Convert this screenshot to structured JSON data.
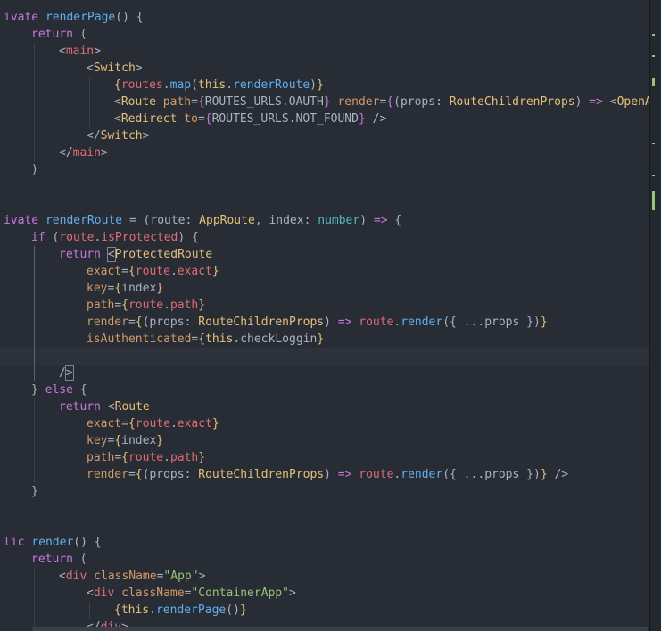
{
  "editor": {
    "lines": [
      {
        "indent": 0,
        "tokens": [
          [
            "kw",
            "ivate "
          ],
          [
            "fn",
            "renderPage"
          ],
          [
            "punc",
            "() {"
          ]
        ]
      },
      {
        "indent": 1,
        "tokens": [
          [
            "kw",
            "return"
          ],
          [
            "punc",
            " ("
          ]
        ]
      },
      {
        "indent": 2,
        "tokens": [
          [
            "punc",
            "<"
          ],
          [
            "tag",
            "main"
          ],
          [
            "punc",
            ">"
          ]
        ]
      },
      {
        "indent": 3,
        "tokens": [
          [
            "punc",
            "<"
          ],
          [
            "comp",
            "Switch"
          ],
          [
            "punc",
            ">"
          ]
        ]
      },
      {
        "indent": 4,
        "tokens": [
          [
            "brace2",
            "{"
          ],
          [
            "prop",
            "routes"
          ],
          [
            "punc",
            "."
          ],
          [
            "fn",
            "map"
          ],
          [
            "punc",
            "("
          ],
          [
            "this",
            "this"
          ],
          [
            "punc",
            "."
          ],
          [
            "fn",
            "renderRoute"
          ],
          [
            "punc",
            ")"
          ],
          [
            "brace2",
            "}"
          ]
        ]
      },
      {
        "indent": 4,
        "tokens": [
          [
            "punc",
            "<"
          ],
          [
            "comp",
            "Route"
          ],
          [
            "var",
            " "
          ],
          [
            "attr",
            "path"
          ],
          [
            "punc",
            "="
          ],
          [
            "brace",
            "{"
          ],
          [
            "var",
            "ROUTES_URLS"
          ],
          [
            "punc",
            "."
          ],
          [
            "var",
            "OAUTH"
          ],
          [
            "brace",
            "}"
          ],
          [
            "var",
            " "
          ],
          [
            "attr",
            "render"
          ],
          [
            "punc",
            "="
          ],
          [
            "brace",
            "{"
          ],
          [
            "punc",
            "("
          ],
          [
            "var",
            "props"
          ],
          [
            "punc",
            ": "
          ],
          [
            "type",
            "RouteChildrenProps"
          ],
          [
            "punc",
            ") "
          ],
          [
            "arrow",
            "=>"
          ],
          [
            "punc",
            " <"
          ],
          [
            "comp",
            "OpenAutho"
          ]
        ]
      },
      {
        "indent": 4,
        "tokens": [
          [
            "punc",
            "<"
          ],
          [
            "comp",
            "Redirect"
          ],
          [
            "var",
            " "
          ],
          [
            "attr",
            "to"
          ],
          [
            "punc",
            "="
          ],
          [
            "brace",
            "{"
          ],
          [
            "var",
            "ROUTES_URLS"
          ],
          [
            "punc",
            "."
          ],
          [
            "var",
            "NOT_FOUND"
          ],
          [
            "brace",
            "}"
          ],
          [
            "punc",
            " />"
          ]
        ]
      },
      {
        "indent": 3,
        "tokens": [
          [
            "punc",
            "</"
          ],
          [
            "comp",
            "Switch"
          ],
          [
            "punc",
            ">"
          ]
        ]
      },
      {
        "indent": 2,
        "tokens": [
          [
            "punc",
            "</"
          ],
          [
            "tag",
            "main"
          ],
          [
            "punc",
            ">"
          ]
        ]
      },
      {
        "indent": 1,
        "tokens": [
          [
            "punc",
            ")"
          ]
        ]
      },
      {
        "indent": 0,
        "tokens": []
      },
      {
        "indent": 0,
        "tokens": []
      },
      {
        "indent": 0,
        "tokens": [
          [
            "kw",
            "ivate "
          ],
          [
            "fn",
            "renderRoute"
          ],
          [
            "punc",
            " = ("
          ],
          [
            "var",
            "route"
          ],
          [
            "punc",
            ": "
          ],
          [
            "type",
            "AppRoute"
          ],
          [
            "punc",
            ", "
          ],
          [
            "var",
            "index"
          ],
          [
            "punc",
            ": "
          ],
          [
            "num",
            "number"
          ],
          [
            "punc",
            ") "
          ],
          [
            "arrow",
            "=>"
          ],
          [
            "punc",
            " {"
          ]
        ]
      },
      {
        "indent": 1,
        "tokens": [
          [
            "kw",
            "if"
          ],
          [
            "punc",
            " ("
          ],
          [
            "prop",
            "route"
          ],
          [
            "punc",
            "."
          ],
          [
            "prop",
            "isProtected"
          ],
          [
            "punc",
            ") {"
          ]
        ]
      },
      {
        "indent": 2,
        "tokens": [
          [
            "kw",
            "return"
          ],
          [
            "punc",
            " "
          ],
          [
            "cursor",
            "<"
          ],
          [
            "comp",
            "ProtectedRoute"
          ]
        ]
      },
      {
        "indent": 3,
        "tokens": [
          [
            "attr",
            "exact"
          ],
          [
            "punc",
            "="
          ],
          [
            "brace2",
            "{"
          ],
          [
            "prop",
            "route"
          ],
          [
            "punc",
            "."
          ],
          [
            "prop",
            "exact"
          ],
          [
            "brace2",
            "}"
          ]
        ]
      },
      {
        "indent": 3,
        "tokens": [
          [
            "attr",
            "key"
          ],
          [
            "punc",
            "="
          ],
          [
            "brace2",
            "{"
          ],
          [
            "var",
            "index"
          ],
          [
            "brace2",
            "}"
          ]
        ]
      },
      {
        "indent": 3,
        "tokens": [
          [
            "attr",
            "path"
          ],
          [
            "punc",
            "="
          ],
          [
            "brace2",
            "{"
          ],
          [
            "prop",
            "route"
          ],
          [
            "punc",
            "."
          ],
          [
            "prop",
            "path"
          ],
          [
            "brace2",
            "}"
          ]
        ]
      },
      {
        "indent": 3,
        "tokens": [
          [
            "attr",
            "render"
          ],
          [
            "punc",
            "="
          ],
          [
            "brace2",
            "{"
          ],
          [
            "punc",
            "("
          ],
          [
            "var",
            "props"
          ],
          [
            "punc",
            ": "
          ],
          [
            "type",
            "RouteChildrenProps"
          ],
          [
            "punc",
            ") "
          ],
          [
            "arrow",
            "=>"
          ],
          [
            "punc",
            " "
          ],
          [
            "prop",
            "route"
          ],
          [
            "punc",
            "."
          ],
          [
            "fn",
            "render"
          ],
          [
            "punc",
            "({ ..."
          ],
          [
            "var",
            "props"
          ],
          [
            "punc",
            " })"
          ],
          [
            "brace2",
            "}"
          ]
        ]
      },
      {
        "indent": 3,
        "tokens": [
          [
            "attr",
            "isAuthenticated"
          ],
          [
            "punc",
            "="
          ],
          [
            "brace2",
            "{"
          ],
          [
            "this",
            "this"
          ],
          [
            "punc",
            "."
          ],
          [
            "var",
            "checkLoggin"
          ],
          [
            "brace2",
            "}"
          ]
        ]
      },
      {
        "indent": 2,
        "current": true,
        "tokens": []
      },
      {
        "indent": 2,
        "tokens": [
          [
            "punc",
            "/"
          ],
          [
            "cursor",
            ">"
          ]
        ]
      },
      {
        "indent": 1,
        "tokens": [
          [
            "punc",
            "} "
          ],
          [
            "kw",
            "else"
          ],
          [
            "punc",
            " {"
          ]
        ]
      },
      {
        "indent": 2,
        "tokens": [
          [
            "kw",
            "return"
          ],
          [
            "punc",
            " <"
          ],
          [
            "comp",
            "Route"
          ]
        ]
      },
      {
        "indent": 3,
        "tokens": [
          [
            "attr",
            "exact"
          ],
          [
            "punc",
            "="
          ],
          [
            "brace2",
            "{"
          ],
          [
            "prop",
            "route"
          ],
          [
            "punc",
            "."
          ],
          [
            "prop",
            "exact"
          ],
          [
            "brace2",
            "}"
          ]
        ]
      },
      {
        "indent": 3,
        "tokens": [
          [
            "attr",
            "key"
          ],
          [
            "punc",
            "="
          ],
          [
            "brace2",
            "{"
          ],
          [
            "var",
            "index"
          ],
          [
            "brace2",
            "}"
          ]
        ]
      },
      {
        "indent": 3,
        "tokens": [
          [
            "attr",
            "path"
          ],
          [
            "punc",
            "="
          ],
          [
            "brace2",
            "{"
          ],
          [
            "prop",
            "route"
          ],
          [
            "punc",
            "."
          ],
          [
            "prop",
            "path"
          ],
          [
            "brace2",
            "}"
          ]
        ]
      },
      {
        "indent": 3,
        "tokens": [
          [
            "attr",
            "render"
          ],
          [
            "punc",
            "="
          ],
          [
            "brace2",
            "{"
          ],
          [
            "punc",
            "("
          ],
          [
            "var",
            "props"
          ],
          [
            "punc",
            ": "
          ],
          [
            "type",
            "RouteChildrenProps"
          ],
          [
            "punc",
            ") "
          ],
          [
            "arrow",
            "=>"
          ],
          [
            "punc",
            " "
          ],
          [
            "prop",
            "route"
          ],
          [
            "punc",
            "."
          ],
          [
            "fn",
            "render"
          ],
          [
            "punc",
            "({ ..."
          ],
          [
            "var",
            "props"
          ],
          [
            "punc",
            " })"
          ],
          [
            "brace2",
            "}"
          ],
          [
            "punc",
            " />"
          ]
        ]
      },
      {
        "indent": 1,
        "tokens": [
          [
            "punc",
            "}"
          ]
        ]
      },
      {
        "indent": 0,
        "tokens": []
      },
      {
        "indent": 0,
        "tokens": []
      },
      {
        "indent": 0,
        "tokens": [
          [
            "kw",
            "lic "
          ],
          [
            "fn",
            "render"
          ],
          [
            "punc",
            "() {"
          ]
        ]
      },
      {
        "indent": 1,
        "tokens": [
          [
            "kw",
            "return"
          ],
          [
            "punc",
            " ("
          ]
        ]
      },
      {
        "indent": 2,
        "tokens": [
          [
            "punc",
            "<"
          ],
          [
            "tag",
            "div"
          ],
          [
            "var",
            " "
          ],
          [
            "attr",
            "className"
          ],
          [
            "punc",
            "="
          ],
          [
            "str",
            "\"App\""
          ],
          [
            "punc",
            ">"
          ]
        ]
      },
      {
        "indent": 3,
        "tokens": [
          [
            "punc",
            "<"
          ],
          [
            "tag",
            "div"
          ],
          [
            "var",
            " "
          ],
          [
            "attr",
            "className"
          ],
          [
            "punc",
            "="
          ],
          [
            "str",
            "\"ContainerApp\""
          ],
          [
            "punc",
            ">"
          ]
        ]
      },
      {
        "indent": 4,
        "tokens": [
          [
            "brace2",
            "{"
          ],
          [
            "this",
            "this"
          ],
          [
            "punc",
            "."
          ],
          [
            "fn",
            "renderPage"
          ],
          [
            "punc",
            "()"
          ],
          [
            "brace2",
            "}"
          ]
        ]
      },
      {
        "indent": 3,
        "tokens": [
          [
            "punc",
            "</"
          ],
          [
            "tag",
            "div"
          ],
          [
            "punc",
            ">"
          ]
        ]
      }
    ]
  },
  "colors": {
    "background": "#282c34",
    "keyword": "#c678dd",
    "function": "#61afef",
    "tag": "#e06c75",
    "component": "#e5c07b",
    "attribute": "#d19a66",
    "string": "#98c379"
  }
}
